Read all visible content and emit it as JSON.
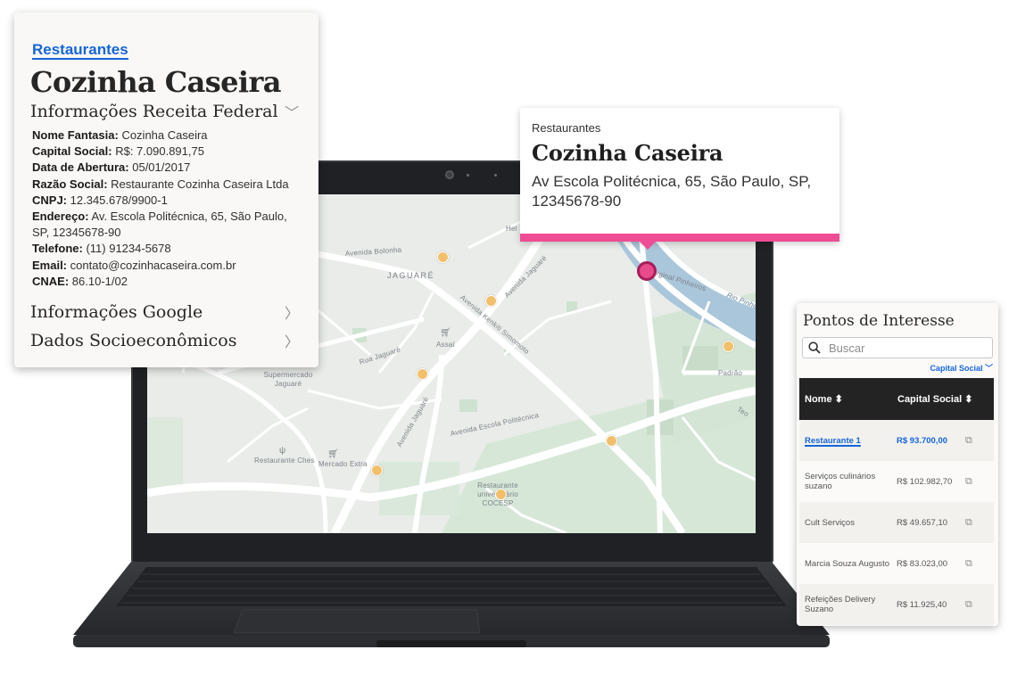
{
  "info_card": {
    "category": "Restaurantes",
    "title": "Cozinha Caseira",
    "receita_section": "Informações Receita Federal",
    "receita_items": [
      {
        "label": "Nome Fantasia:",
        "value": "Cozinha Caseira"
      },
      {
        "label": "Capital Social:",
        "value": "R$: 7.090.891,75"
      },
      {
        "label": "Data de Abertura:",
        "value": "05/01/2017"
      },
      {
        "label": "Razão Social:",
        "value": "Restaurante Cozinha Caseira Ltda"
      },
      {
        "label": "CNPJ:",
        "value": "12.345.678/9900-1"
      },
      {
        "label": "Endereço:",
        "value": "Av. Escola Politécnica, 65, São Paulo, SP, 12345678-90"
      },
      {
        "label": "Telefone:",
        "value": "(11) 91234-5678"
      },
      {
        "label": "Email:",
        "value": "contato@cozinhacaseira.com.br"
      },
      {
        "label": "CNAE:",
        "value": "86.10-1/02"
      }
    ],
    "google_section": "Informações Google",
    "socio_section": "Dados Socioeconômicos"
  },
  "popup": {
    "category": "Restaurantes",
    "title": "Cozinha Caseira",
    "address": "Av Escola Politécnica, 65, São Paulo, SP, 12345678-90"
  },
  "map": {
    "labels": {
      "avenida_bolonha": "Avenida Bolonha",
      "jaguare": "JAGUARÉ",
      "avenida_jaguare": "Avenida Jaguaré",
      "avenida_kenkiti": "Avenida Kenkiti Simomoto",
      "rua_jaguare": "Rua Jaguaré",
      "assai": "Assaí",
      "supermercado": "Supermercado Jaguaré",
      "avenida_jaguare_2": "Avenida Jaguaré",
      "avenida_escola": "Avenida Escola Politécnica",
      "restaurante_ches": "Restaurante Ches",
      "mercado_extra": "Mercado Extra",
      "restaurante_univ": "Restaurante universitário COCESP",
      "marginal": "Marginal Pinheiros",
      "rio_pinheiros": "Rio Pinheiros",
      "padrao": "Padrão",
      "hel": "Hel",
      "teo": "Teo"
    },
    "accent": "#ee4d95"
  },
  "poi": {
    "title": "Pontos de Interesse",
    "search_placeholder": "Buscar",
    "sort_label": "Capital Social",
    "columns": [
      "Nome",
      "Capital Social"
    ],
    "rows": [
      {
        "name": "Restaurante 1",
        "capital": "R$ 93.700,00",
        "active": true
      },
      {
        "name": "Serviços culinários suzano",
        "capital": "R$ 102.982,70",
        "active": false
      },
      {
        "name": "Cult Serviços",
        "capital": "R$ 49.657,10",
        "active": false
      },
      {
        "name": "Marcia Souza Augusto",
        "capital": "R$ 83.023,00",
        "active": false
      },
      {
        "name": "Refeições Delivery Suzano",
        "capital": "R$ 11.925,40",
        "active": false
      }
    ]
  }
}
